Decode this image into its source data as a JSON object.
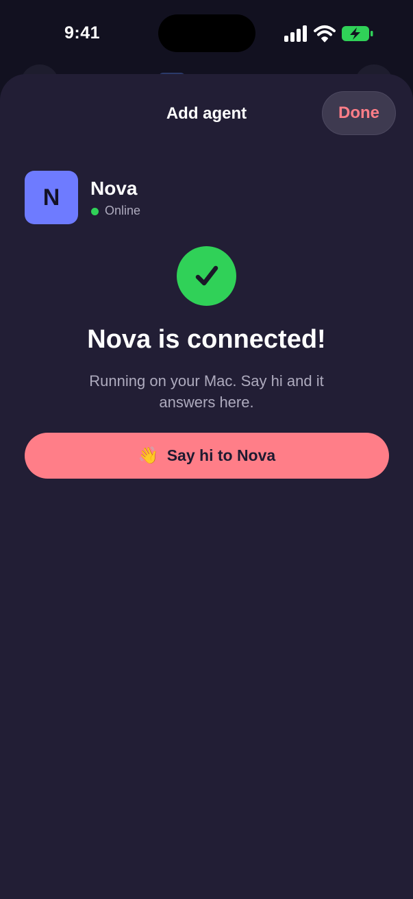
{
  "status_bar": {
    "time": "9:41",
    "icons": [
      "cellular-signal-icon",
      "wifi-icon",
      "battery-charging-icon"
    ],
    "battery_color": "#30d158"
  },
  "sheet": {
    "title": "Add agent",
    "done_label": "Done"
  },
  "agent": {
    "initial": "N",
    "name": "Nova",
    "status": "Online",
    "avatar_color": "#6e7bff",
    "status_color": "#30d158"
  },
  "confirmation": {
    "icon": "checkmark-icon",
    "headline": "Nova is connected!",
    "subtext": "Running on your Mac. Say hi and it answers here."
  },
  "primary_action": {
    "icon": "waving-hand-icon",
    "label": "Say hi to Nova"
  },
  "colors": {
    "accent": "#ff7e88",
    "sheet_background": "#221e35",
    "success": "#30d158"
  }
}
